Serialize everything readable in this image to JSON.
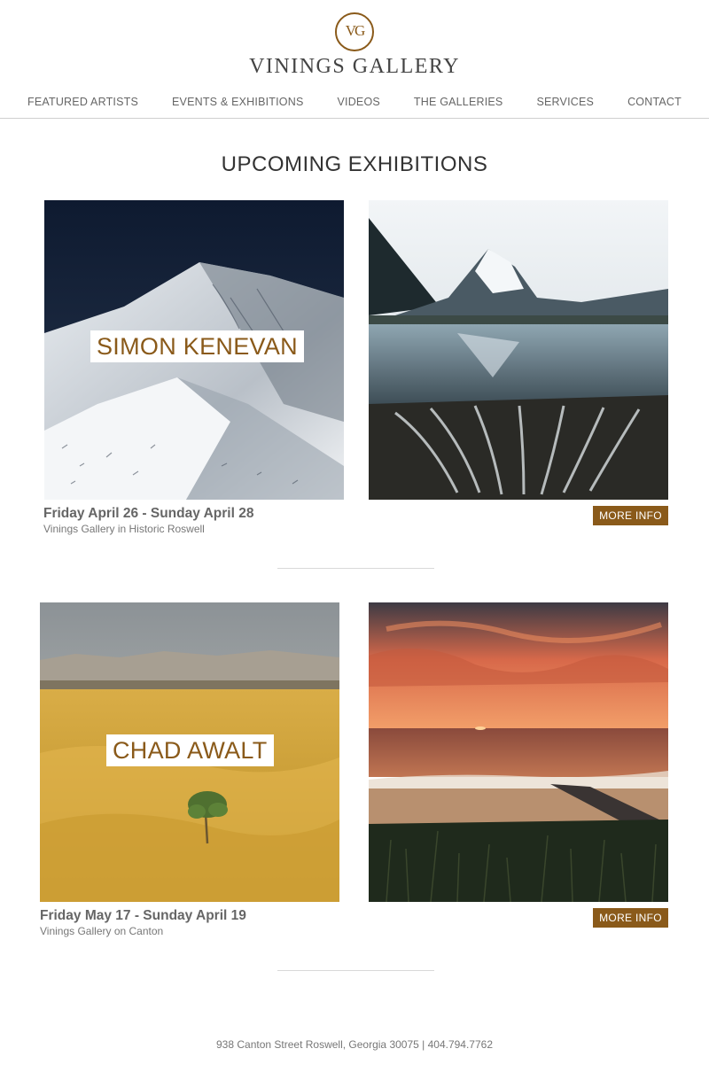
{
  "brand": {
    "monogram": "VG",
    "name": "VININGS GALLERY",
    "accent_color": "#8a5a1a"
  },
  "nav": {
    "items": [
      {
        "label": "FEATURED ARTISTS"
      },
      {
        "label": "EVENTS & EXHIBITIONS"
      },
      {
        "label": "VIDEOS"
      },
      {
        "label": "THE GALLERIES"
      },
      {
        "label": "SERVICES"
      },
      {
        "label": "CONTACT"
      }
    ]
  },
  "page": {
    "title": "UPCOMING EXHIBITIONS"
  },
  "exhibitions": [
    {
      "artist": "SIMON KENEVAN",
      "dates": "Friday April 26 - Sunday April 28",
      "venue": "Vinings Gallery in Historic Roswell",
      "more_label": "MORE INFO"
    },
    {
      "artist": "CHAD AWALT",
      "dates": "Friday May 17 - Sunday April 19",
      "venue": "Vinings Gallery on Canton",
      "more_label": "MORE INFO"
    }
  ],
  "footer": {
    "text": "938 Canton Street Roswell, Georgia 30075 | 404.794.7762"
  }
}
